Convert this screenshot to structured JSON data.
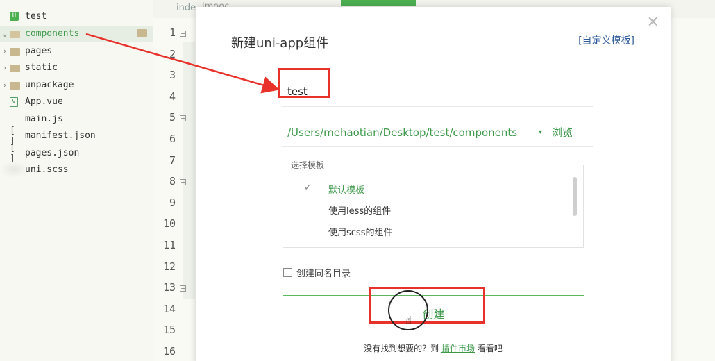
{
  "tree": {
    "project": "test",
    "items": [
      {
        "label": "components",
        "kind": "folder-open"
      },
      {
        "label": "pages",
        "kind": "folder"
      },
      {
        "label": "static",
        "kind": "folder"
      },
      {
        "label": "unpackage",
        "kind": "folder"
      },
      {
        "label": "App.vue",
        "kind": "vue"
      },
      {
        "label": "main.js",
        "kind": "js"
      },
      {
        "label": "manifest.json",
        "kind": "json",
        "icon_text": "[ ]"
      },
      {
        "label": "pages.json",
        "kind": "json",
        "icon_text": "[ ]"
      },
      {
        "label": "uni.scss",
        "kind": "scss"
      }
    ]
  },
  "editor": {
    "tab_label": "inde",
    "watermark": "imooc",
    "line_numbers": [
      "1",
      "2",
      "3",
      "4",
      "5",
      "6",
      "7",
      "8",
      "9",
      "10",
      "11",
      "12",
      "13",
      "14",
      "15",
      "16"
    ],
    "fold_marks": [
      "⊟",
      "⊟",
      "⊟",
      "⊟"
    ]
  },
  "dialog": {
    "title": "新建uni-app组件",
    "custom_template_link": "[自定义模板]",
    "close_glyph": "✕",
    "name_value": "test",
    "path": "/Users/mehaotian/Desktop/test/components",
    "path_caret": "▾",
    "browse_label": "浏览",
    "template_legend": "选择模板",
    "templates": [
      "默认模板",
      "使用less的组件",
      "使用scss的组件"
    ],
    "selected_check": "✓",
    "same_dir_label": "创建同名目录",
    "create_label": "创建",
    "footer_prefix": "没有找到想要的？到",
    "footer_link": "插件市场",
    "footer_suffix": "看看吧"
  },
  "colors": {
    "accent": "#3f9a4c",
    "annotation": "#e8312a",
    "link": "#2f5d9a"
  }
}
